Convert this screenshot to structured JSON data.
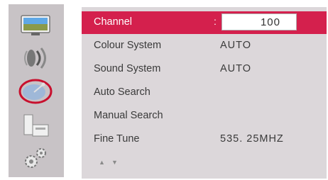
{
  "sidebar": {
    "items": [
      {
        "icon": "picture-icon"
      },
      {
        "icon": "sound-icon"
      },
      {
        "icon": "satellite-dish-icon",
        "active": true
      },
      {
        "icon": "features-icon"
      },
      {
        "icon": "settings-gears-icon"
      }
    ]
  },
  "menu": {
    "channel": {
      "label": "Channel",
      "separator": ":",
      "value": "100"
    },
    "items": [
      {
        "label": "Colour System",
        "value": "AUTO"
      },
      {
        "label": "Sound System",
        "value": "AUTO"
      },
      {
        "label": "Auto Search",
        "value": ""
      },
      {
        "label": "Manual Search",
        "value": ""
      },
      {
        "label": "Fine Tune",
        "value": "535. 25MHZ"
      }
    ]
  },
  "nav": {
    "up": "▲",
    "down": "▼"
  },
  "colors": {
    "accent": "#d4204d",
    "panel": "#dcd7da",
    "rail": "#c8c3c6",
    "text": "#3a3a3a"
  }
}
